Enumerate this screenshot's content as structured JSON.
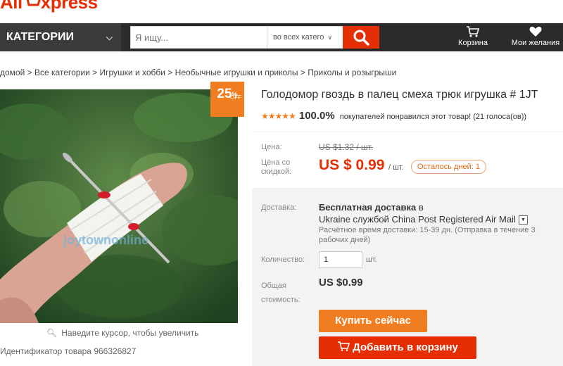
{
  "logo": {
    "text_ali": "Ali",
    "text_rest": "xpress"
  },
  "header": {
    "categories_label": "КАТЕГОРИИ",
    "search_placeholder": "Я ищу...",
    "search_scope": "во всех катего",
    "cart_label": "Корзина",
    "wishlist_label": "Мои желания"
  },
  "breadcrumb": "домой > Все категории > Игрушки и хобби > Необычные игрушки и приколы > Приколы и розыгрыши",
  "product": {
    "discount_pct": "25",
    "discount_sign": "%",
    "discount_off": "OFF",
    "watermark": "joytownonline",
    "zoom_hint": "Наведите курсор, чтобы увеличить",
    "id_label": "Идентификатор товара",
    "id_value": "966326827",
    "title": "Голодомор гвоздь в палец смеха трюк игрушка # 1JT",
    "stars": "★★★★★",
    "rating_pct": "100.0%",
    "rating_text": "покупателей понравился этот товар! (21 голоса(ов))"
  },
  "price": {
    "price_label": "Цена:",
    "old_price": "US $1.32 / шт.",
    "sale_label_1": "Цена со",
    "sale_label_2": "скидкой:",
    "new_price": "US $ 0.99",
    "new_unit": "/ шт.",
    "days_left": "Осталось дней: 1"
  },
  "shipping": {
    "label": "Доставка:",
    "free": "Бесплатная доставка",
    "in": "в",
    "method": "Ukraine службой China Post Registered Air Mail",
    "time": "Расчётное время доставки: 15-39 дн. (Отправка в течение 3 рабочих дней)"
  },
  "quantity": {
    "label": "Количество:",
    "value": "1",
    "unit": "шт."
  },
  "total": {
    "label_1": "Общая",
    "label_2": "стоимость:",
    "value": "US $0.99"
  },
  "buttons": {
    "buy_now": "Купить сейчас",
    "add_to_cart": "Добавить в корзину"
  },
  "colors": {
    "brand": "#e62e04",
    "accent": "#f07d1f",
    "header_bg": "#2b2b2b"
  }
}
